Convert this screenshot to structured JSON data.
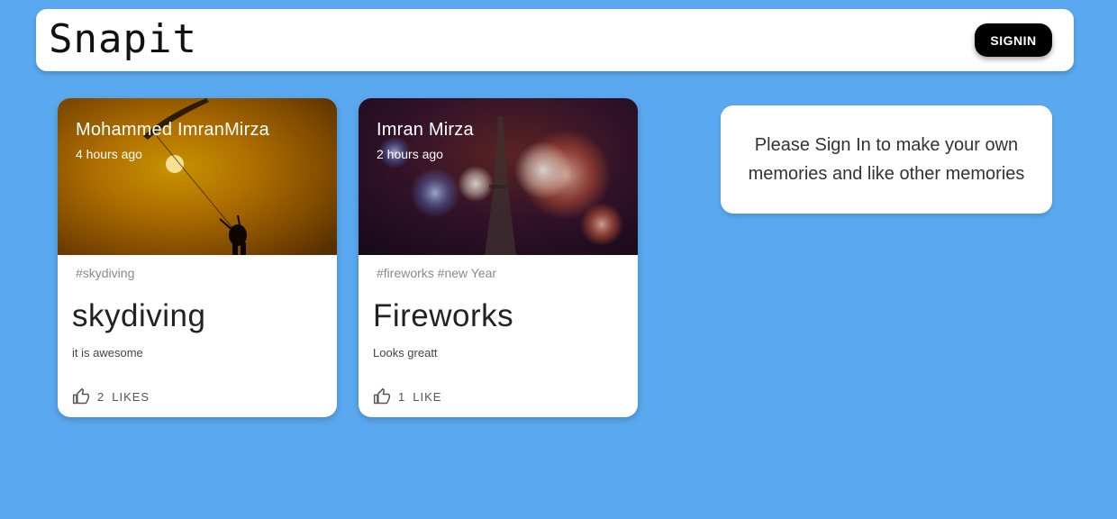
{
  "header": {
    "logo_text": "Snapit",
    "signin_label": "SIGNIN"
  },
  "posts": [
    {
      "author": "Mohammed ImranMirza",
      "time": "4 hours ago",
      "tags": "#skydiving",
      "title": "skydiving",
      "message": "it is awesome",
      "like_count": "2",
      "like_label": "LIKES",
      "image_icon": "skydiving-photo"
    },
    {
      "author": "Imran Mirza",
      "time": "2 hours ago",
      "tags": "#fireworks #new Year",
      "title": "Fireworks",
      "message": "Looks greatt",
      "like_count": "1",
      "like_label": "LIKE",
      "image_icon": "fireworks-photo"
    }
  ],
  "notice": {
    "text": "Please Sign In to make your own memories and like other memories"
  },
  "colors": {
    "background": "#5aa9f0",
    "surface": "#ffffff",
    "button": "#000000"
  }
}
